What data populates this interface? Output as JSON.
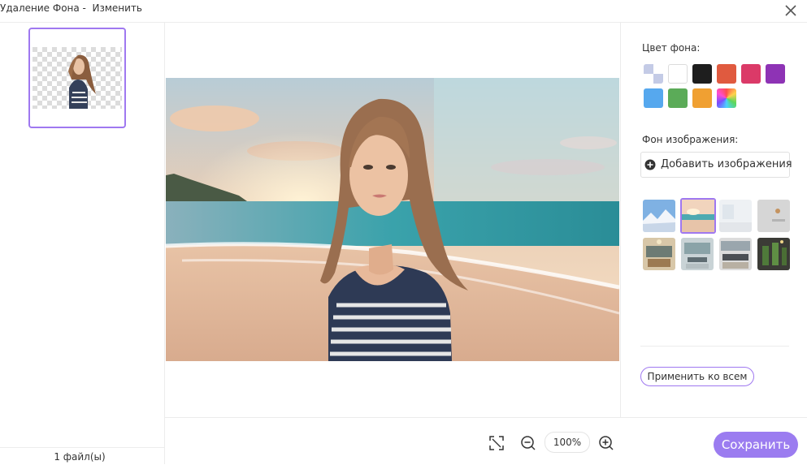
{
  "window": {
    "title": "Удаление Фона -  Изменить"
  },
  "sidebar": {
    "file_count": "1 файл(ы)"
  },
  "toolbar": {
    "zoom": "100%",
    "save_label": "Сохранить"
  },
  "right_panel": {
    "bg_color_label": "Цвет фона:",
    "bg_colors": [
      "transparent",
      "#ffffff",
      "#1e1e1e",
      "#e05a3f",
      "#db3a68",
      "#8e33b5",
      "#56a8ee",
      "#5bab58",
      "#f0a032",
      "gradient"
    ],
    "bg_image_label": "Фон изображения:",
    "add_image_label": "Добавить изображения",
    "bg_images": [
      "snowy-mountains",
      "beach-sunset",
      "white-room",
      "grey-wall",
      "office",
      "meeting-room",
      "kitchen",
      "plants"
    ],
    "apply_all_label": "Применить ко всем"
  },
  "icons": [
    "close-icon",
    "plus-circle-icon",
    "fit-screen-icon",
    "zoom-out-icon",
    "zoom-in-icon"
  ]
}
